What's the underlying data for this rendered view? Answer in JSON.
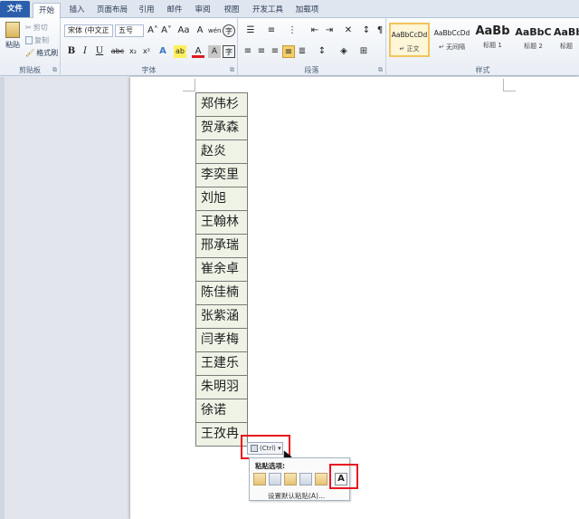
{
  "tabs": [
    {
      "label": "文件",
      "kind": "file"
    },
    {
      "label": "开始",
      "kind": "active"
    },
    {
      "label": "插入",
      "kind": ""
    },
    {
      "label": "页面布局",
      "kind": ""
    },
    {
      "label": "引用",
      "kind": ""
    },
    {
      "label": "邮件",
      "kind": ""
    },
    {
      "label": "审阅",
      "kind": ""
    },
    {
      "label": "视图",
      "kind": ""
    },
    {
      "label": "开发工具",
      "kind": ""
    },
    {
      "label": "加载项",
      "kind": ""
    }
  ],
  "clipboard": {
    "group_label": "剪贴板",
    "paste_label": "粘贴",
    "cut_label": "剪切",
    "copy_label": "复制",
    "format_painter_label": "格式刷"
  },
  "font": {
    "group_label": "字体",
    "font_name": "宋体 (中文正",
    "font_size": "五号",
    "bold": "B",
    "italic": "I",
    "underline": "U",
    "strike": "abc",
    "subscript": "x₂",
    "superscript": "x²",
    "text_effects": "A",
    "highlight": "ab",
    "font_color": "A",
    "char_shading": "A",
    "enclose": "字",
    "grow": "A˄",
    "shrink": "A˅",
    "change_case": "Aa",
    "clear_format": "A",
    "phonetic": "wén",
    "enclose_char": "字"
  },
  "paragraph": {
    "group_label": "段落"
  },
  "styles": {
    "group_label": "样式",
    "items": [
      {
        "preview": "AaBbCcDd",
        "name": "正文",
        "selected": true
      },
      {
        "preview": "AaBbCcDd",
        "name": "无间隔",
        "selected": false
      },
      {
        "preview": "AaBb",
        "name": "标题 1",
        "selected": false
      },
      {
        "preview": "AaBbC",
        "name": "标题 2",
        "selected": false
      },
      {
        "preview": "AaBb",
        "name": "标题",
        "selected": false
      }
    ]
  },
  "document": {
    "names": [
      "郑伟杉",
      "贺承森",
      "赵炎",
      "李奕里",
      "刘旭",
      "王翰林",
      "邢承瑞",
      "崔余卓",
      "陈佳楠",
      "张紫涵",
      "闫孝梅",
      "王建乐",
      "朱明羽",
      "徐诺",
      "王孜冉"
    ]
  },
  "paste_options": {
    "button_label": "(Ctrl)",
    "menu_title": "粘贴选项:",
    "icons": [
      "keep-source-formatting-icon",
      "merge-table-icon",
      "nest-table-icon",
      "insert-rows-icon",
      "overwrite-cells-icon",
      "keep-text-only-icon"
    ],
    "text_only_glyph": "A",
    "set_default_label": "设置默认粘贴(A)..."
  },
  "colors": {
    "file_tab": "#2b5fac",
    "cell_fill": "#eef3e6",
    "highlight_red": "#e8141e",
    "style_selected": "#f2c45c"
  }
}
